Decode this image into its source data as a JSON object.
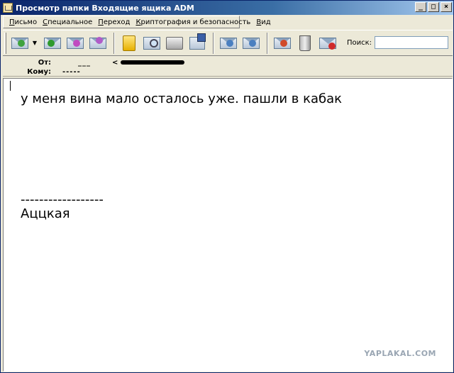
{
  "window": {
    "title": "Просмотр папки Входящие ящика ADM",
    "buttons": {
      "minimize": "_",
      "maximize": "□",
      "close": "×"
    }
  },
  "menu": {
    "items": [
      "Письмо",
      "Специальное",
      "Переход",
      "Криптография и безопасность",
      "Вид"
    ]
  },
  "toolbar": {
    "search_label": "Поиск:",
    "search_value": "",
    "icons": [
      "get-mail-icon",
      "reply-all-icon",
      "forward-icon",
      "move-icon",
      "address-book-icon",
      "find-icon",
      "print-icon",
      "save-icon",
      "prev-icon",
      "next-icon",
      "mark-icon",
      "trash-icon",
      "junk-icon"
    ]
  },
  "headers": {
    "from_label": "От:",
    "from_value": "___",
    "to_label": "Кому:",
    "to_value": "-----"
  },
  "message": {
    "line1": "у меня вина мало осталось уже. пашли в кабак",
    "separator": "------------------",
    "signature": "Аццкая"
  },
  "watermark": "YAPLAKAL.COM",
  "colors": {
    "titlebar_start": "#0a246a",
    "titlebar_end": "#a6caf0",
    "chrome": "#ece9d8"
  }
}
